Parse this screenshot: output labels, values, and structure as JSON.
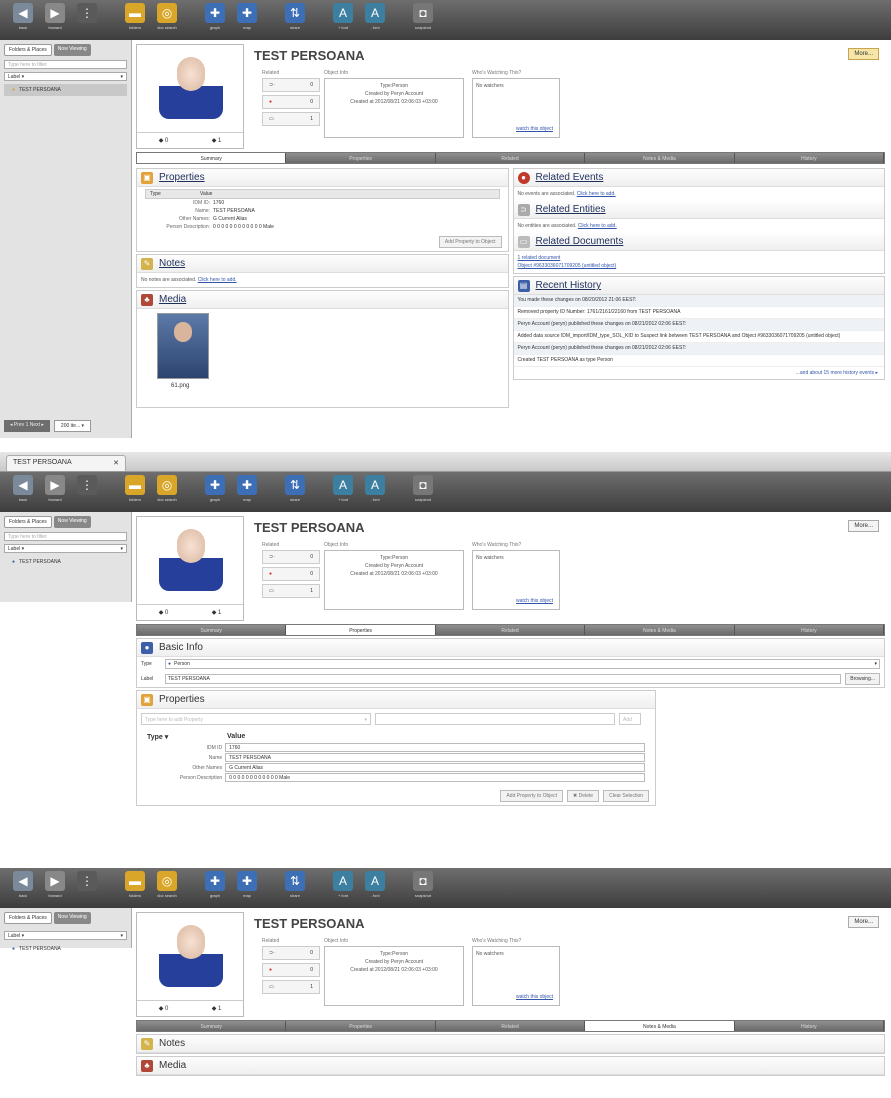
{
  "toolbar": {
    "buttons": [
      {
        "label": "back",
        "icon": "arrow-left-icon",
        "color": "#7a8a9a"
      },
      {
        "label": "forward",
        "icon": "arrow-right-icon",
        "color": "#888888"
      },
      {
        "label": "",
        "icon": "handle-icon",
        "color": "#5a5a5a"
      },
      {
        "label": "folders",
        "icon": "folder-icon",
        "color": "#d9a629"
      },
      {
        "label": "doc search",
        "icon": "search-icon",
        "color": "#d9a629"
      },
      {
        "label": "graph",
        "icon": "graph-icon",
        "color": "#3d6fb6"
      },
      {
        "label": "map",
        "icon": "map-icon",
        "color": "#3d6fb6"
      },
      {
        "label": "share",
        "icon": "share-icon",
        "color": "#3d6fb6"
      },
      {
        "label": "+ font",
        "icon": "font-increase-icon",
        "color": "#3d7fa0"
      },
      {
        "label": "- font",
        "icon": "font-decrease-icon",
        "color": "#3d7fa0"
      },
      {
        "label": "snapshot",
        "icon": "camera-icon",
        "color": "#777777"
      }
    ]
  },
  "left": {
    "tab1": "Folders & Places",
    "tab2": "Now Viewing",
    "search": "Type here to filter",
    "label_select": "Label ▾",
    "item": "TEST PERSOANA",
    "pager": "◂ Prev 1 Next ▸",
    "page_size": "200 ite... ▾"
  },
  "doc_tab": "TEST PERSOANA",
  "title": "TEST PERSOANA",
  "more": "More...",
  "counts": {
    "a": "0",
    "b": "1"
  },
  "related": {
    "label": "Related",
    "r1": "0",
    "r2": "0",
    "r3": "1"
  },
  "object_info": {
    "label": "Object Info",
    "type": "Type:Person",
    "created_by": "Created by Peryn Account",
    "created_at": "Created at 2012/08/21 02:06:03 +03:00"
  },
  "watch": {
    "label": "Who's Watching This?",
    "none": "No watchers",
    "link": "watch this object"
  },
  "tabs": [
    "Summary",
    "Properties",
    "Related",
    "Notes & Media",
    "History"
  ],
  "summary": {
    "properties": "Properties",
    "prop_header": [
      "Type",
      "Value"
    ],
    "props": [
      [
        "IDM ID:",
        "1760"
      ],
      [
        "Name:",
        "TEST PERSOANA"
      ],
      [
        "Other Names:",
        "G Current Alias"
      ],
      [
        "Person Description:",
        "0 0 0 0 0 0 0 0 0 0 0 0 Male"
      ]
    ],
    "add_prop_btn": "Add Property to Object",
    "notes": "Notes",
    "notes_text": "No notes are associated.",
    "notes_link": "Click here to add.",
    "media": "Media",
    "media_caption": "61.png",
    "related_events": "Related Events",
    "events_text": "No events are associated.",
    "events_link": "Click here to add.",
    "related_entities": "Related Entities",
    "entities_text": "No entities are associated.",
    "entities_link": "Click here to add.",
    "related_documents": "Related Documents",
    "doc_count": "1 related document",
    "doc_link": "Object #9633036071709205 (untitled object)",
    "recent_history": "Recent History",
    "history": [
      "You made these changes on 08/20/2012 21:06 EEST:",
      "Removed property ID Number: 1761/2161/22160 from TEST PERSOANA",
      "Peryn Account (peryn) published these changes on 08/21/2012 02:06 EEST:",
      "Added data source IDM_import/IDM_type_SOL_KID to Suspect link between TEST PERSOANA and Object #9633036071709205 (untitled object)",
      "Peryn Account (peryn) published these changes on 08/21/2012 02:06 EEST:",
      "Created TEST PERSOANA as type Person"
    ],
    "history_more": "...and about 15 more history events ▸"
  },
  "props_view": {
    "basic_info": "Basic Info",
    "type_label": "Type",
    "type_value": "Person",
    "label_label": "Label",
    "label_value": "TEST PERSOANA",
    "browse_btn": "Browsing...",
    "properties": "Properties",
    "add_placeholder": "Type here to add Property",
    "add_btn": "Add",
    "header": [
      "Type ▾",
      "Value"
    ],
    "props": [
      [
        "IDM ID",
        "1760"
      ],
      [
        "Name",
        "TEST PERSOANA"
      ],
      [
        "Other Names",
        "G Current Alias"
      ],
      [
        "Person Description",
        "0 0 0 0 0 0 0 0 0 0 0 0 Male"
      ]
    ],
    "btn1": "Add Property to Object",
    "btn2": "✖ Delete",
    "btn3": "Clear Selection"
  },
  "notes_view": {
    "notes": "Notes",
    "media": "Media"
  }
}
